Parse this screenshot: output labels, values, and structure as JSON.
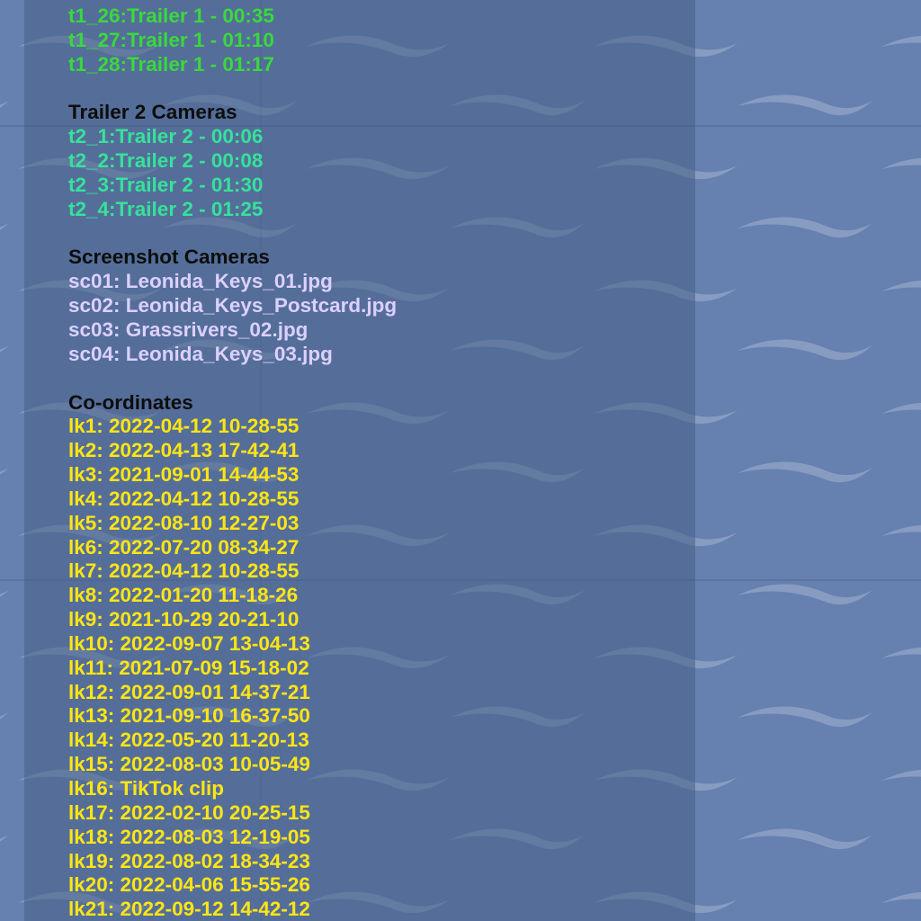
{
  "colors": {
    "background": "#6680b0",
    "trailer1": "#39d93c",
    "trailer2": "#36e29a",
    "screenshot": "#dcd0ff",
    "coordinates": "#ffe514",
    "heading": "#0d0d0d"
  },
  "trailer1": {
    "items": [
      "t1_26:Trailer 1 - 00:35",
      "t1_27:Trailer 1 - 01:10",
      "t1_28:Trailer 1 - 01:17"
    ]
  },
  "trailer2": {
    "heading": "Trailer 2 Cameras",
    "items": [
      "t2_1:Trailer 2 - 00:06",
      "t2_2:Trailer 2 - 00:08",
      "t2_3:Trailer 2 - 01:30",
      "t2_4:Trailer 2 - 01:25"
    ]
  },
  "screenshots": {
    "heading": "Screenshot Cameras",
    "items": [
      "sc01: Leonida_Keys_01.jpg",
      "sc02: Leonida_Keys_Postcard.jpg",
      "sc03: Grassrivers_02.jpg",
      "sc04: Leonida_Keys_03.jpg"
    ]
  },
  "coordinates": {
    "heading": "Co-ordinates",
    "items": [
      "lk1: 2022-04-12 10-28-55",
      "lk2: 2022-04-13 17-42-41",
      "lk3: 2021-09-01 14-44-53",
      "lk4: 2022-04-12 10-28-55",
      "lk5: 2022-08-10 12-27-03",
      "lk6: 2022-07-20 08-34-27",
      "lk7: 2022-04-12 10-28-55",
      "lk8: 2022-01-20 11-18-26",
      "lk9: 2021-10-29 20-21-10",
      "lk10: 2022-09-07 13-04-13",
      "lk11: 2021-07-09 15-18-02",
      "lk12: 2022-09-01 14-37-21",
      "lk13: 2021-09-10 16-37-50",
      "lk14: 2022-05-20 11-20-13",
      "lk15: 2022-08-03 10-05-49",
      "lk16: TikTok clip",
      "lk17: 2022-02-10 20-25-15",
      "lk18: 2022-08-03 12-19-05",
      "lk19: 2022-08-02 18-34-23",
      "lk20: 2022-04-06 15-55-26",
      "lk21: 2022-09-12 14-42-12"
    ]
  }
}
